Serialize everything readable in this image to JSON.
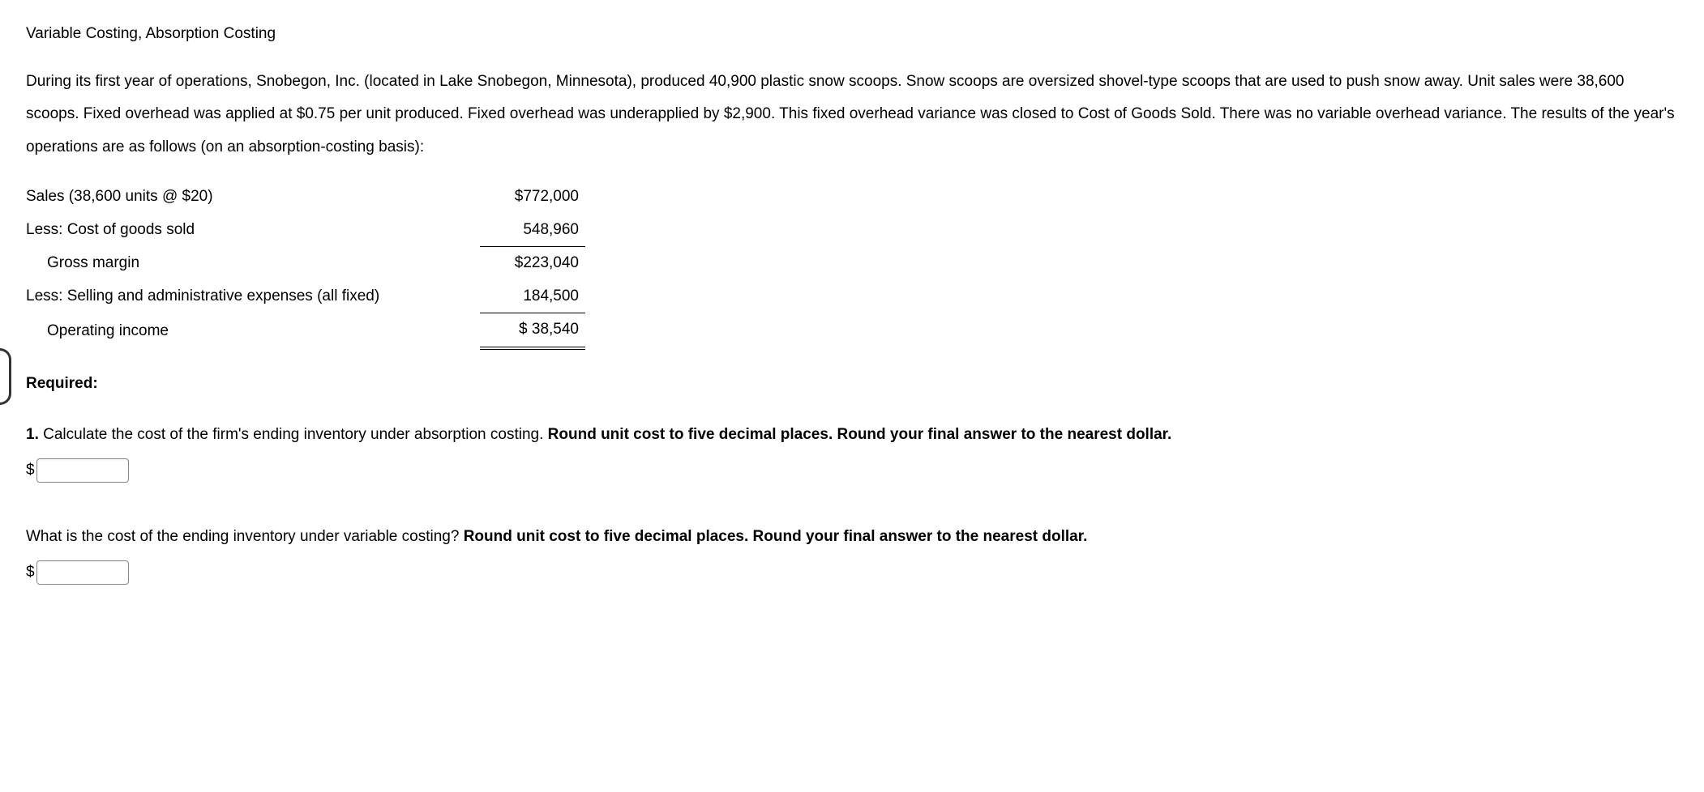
{
  "title": "Variable Costing, Absorption Costing",
  "paragraph": "During its first year of operations, Snobegon, Inc. (located in Lake Snobegon, Minnesota), produced 40,900 plastic snow scoops. Snow scoops are oversized shovel-type scoops that are used to push snow away. Unit sales were 38,600 scoops. Fixed overhead was applied at $0.75 per unit produced. Fixed overhead was underapplied by $2,900. This fixed overhead variance was closed to Cost of Goods Sold. There was no variable overhead variance. The results of the year's operations are as follows (on an absorption-costing basis):",
  "table": {
    "rows": [
      {
        "label": "Sales (38,600 units @ $20)",
        "value": "$772,000",
        "indent": false
      },
      {
        "label": "Less: Cost of goods sold",
        "value": "548,960",
        "indent": false
      },
      {
        "label": "Gross margin",
        "value": "$223,040",
        "indent": true
      },
      {
        "label": "Less: Selling and administrative expenses (all fixed)",
        "value": "184,500",
        "indent": false
      },
      {
        "label": "Operating income",
        "value": "$ 38,540",
        "indent": true
      }
    ]
  },
  "required_label": "Required:",
  "question1": {
    "prefix": "1. ",
    "text": "Calculate the cost of the firm's ending inventory under absorption costing. ",
    "bold": "Round unit cost to five decimal places. Round your final answer to the nearest dollar."
  },
  "question2": {
    "text": "What is the cost of the ending inventory under variable costing? ",
    "bold": "Round unit cost to five decimal places. Round your final answer to the nearest dollar."
  },
  "currency_symbol": "$"
}
